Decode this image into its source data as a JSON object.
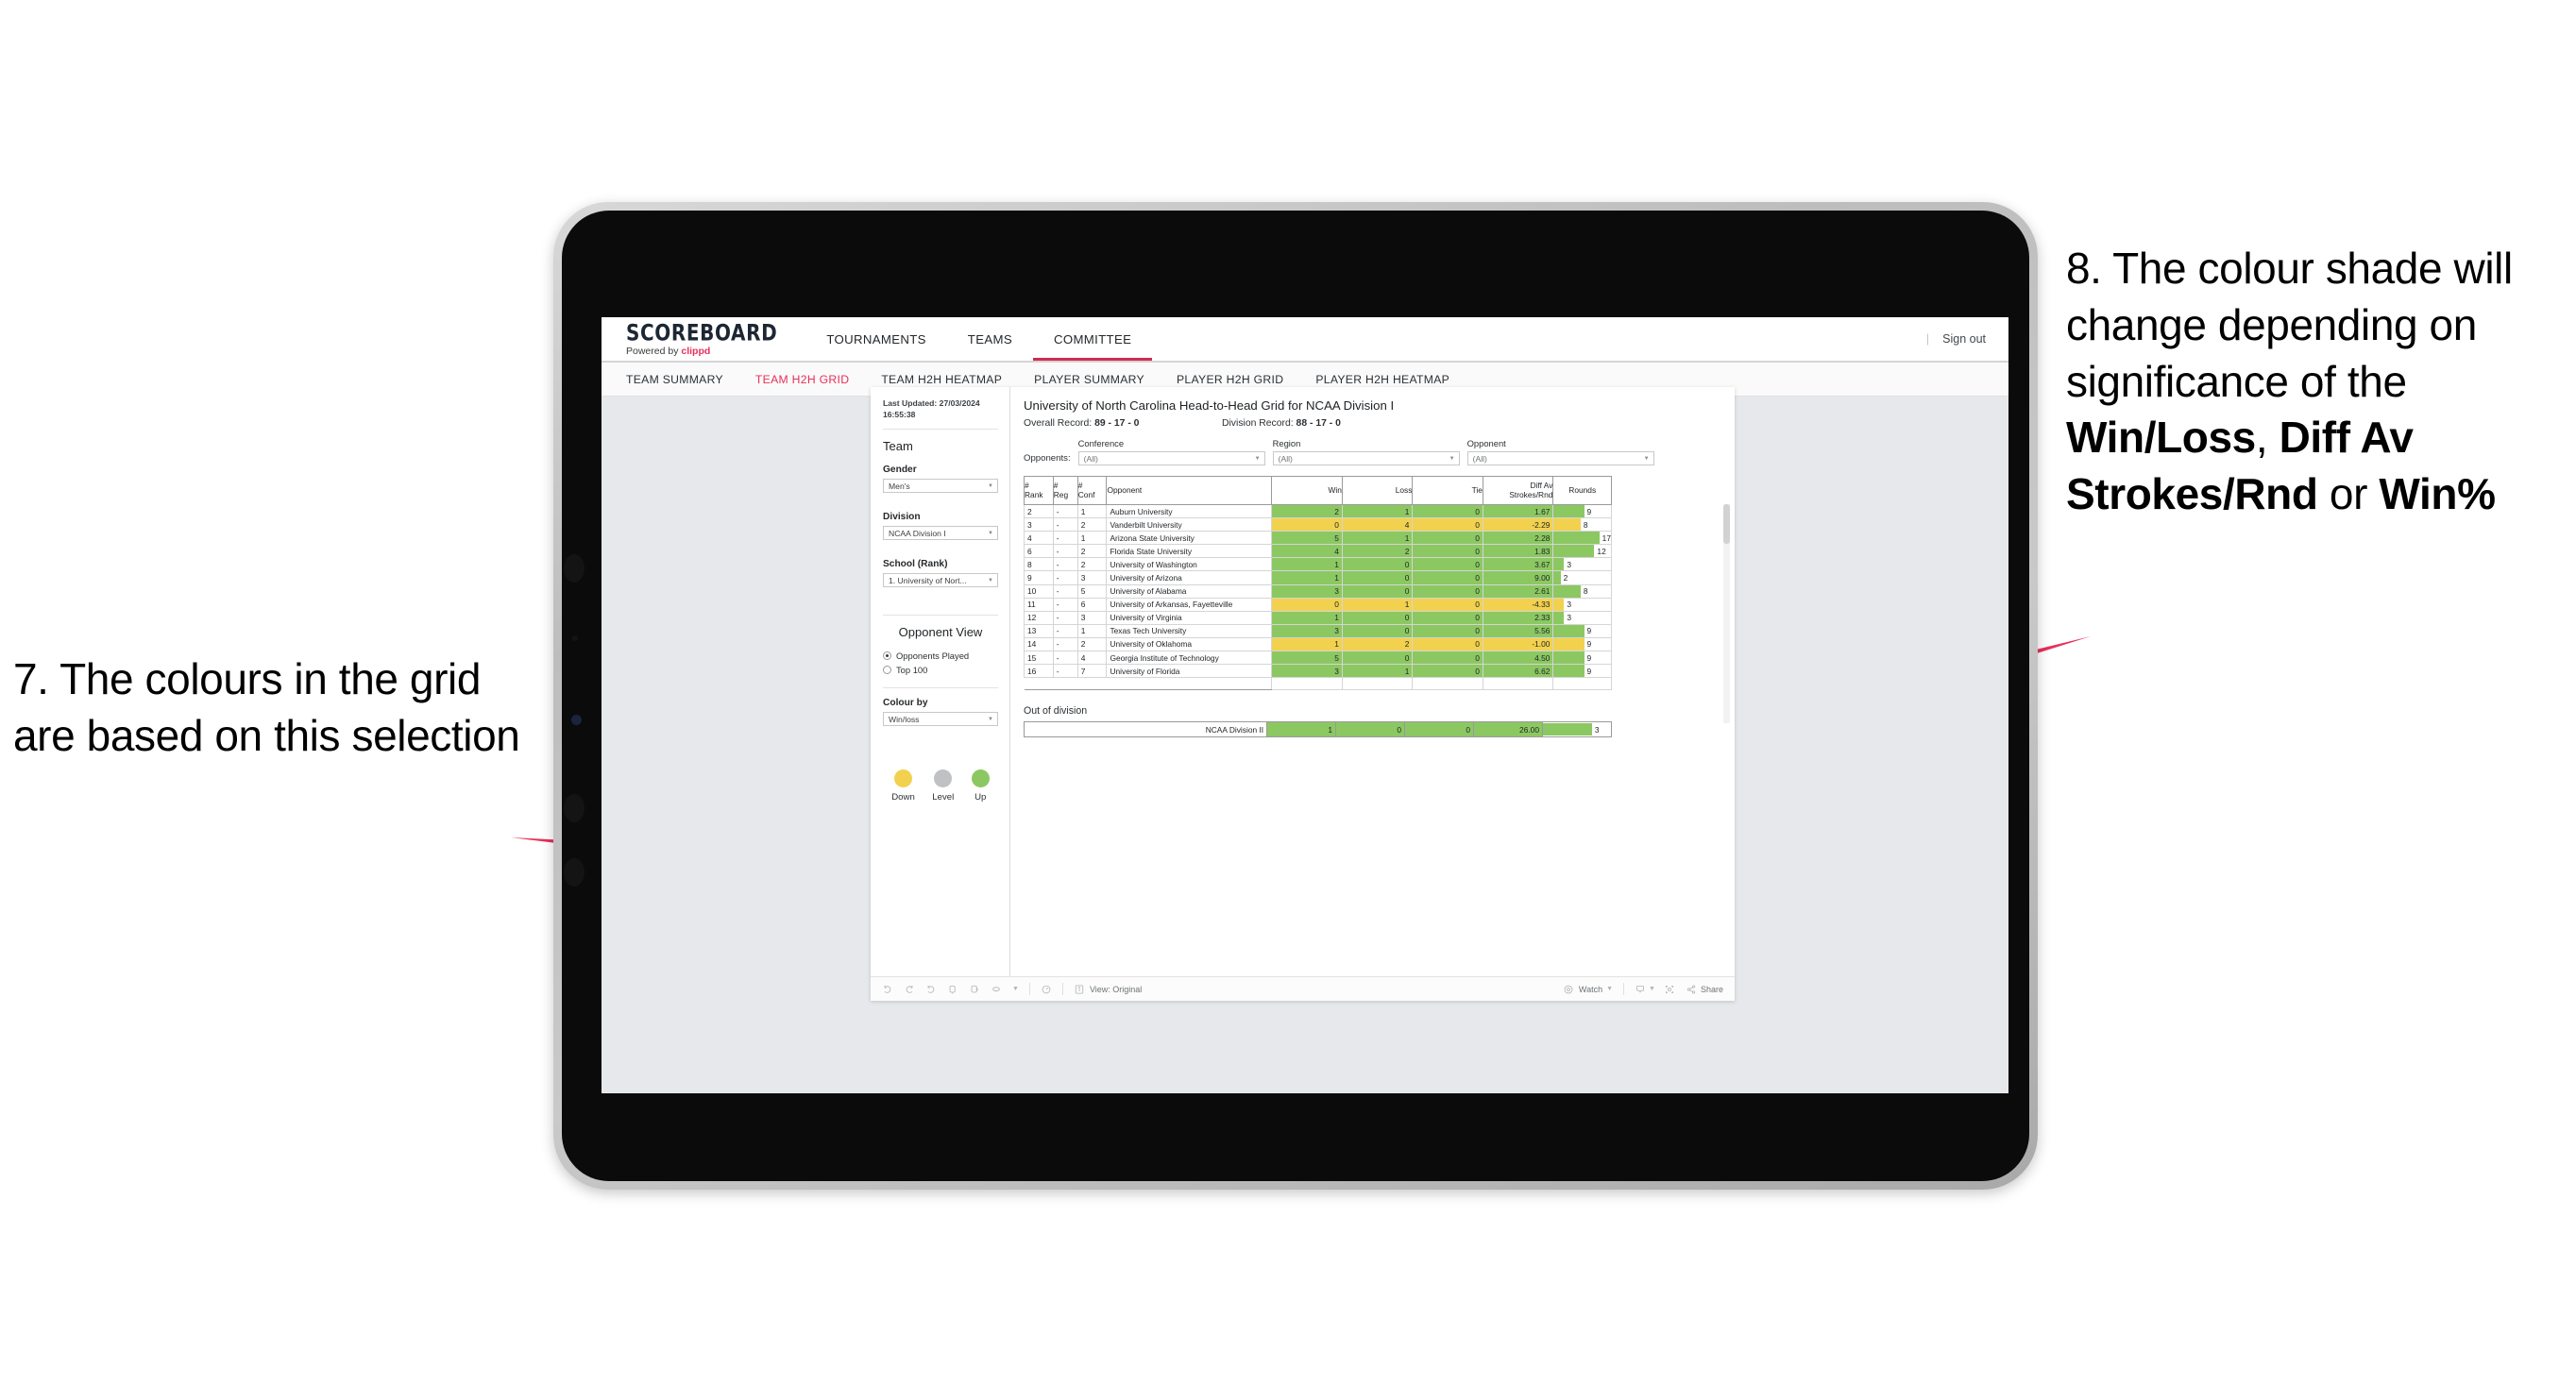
{
  "annotations": {
    "left": {
      "number": "7.",
      "text": "The colours in the grid are based on this selection"
    },
    "right": {
      "line1": "8. The colour shade will change depending on significance of the ",
      "bold1": "Win/Loss",
      "mid1": ", ",
      "bold2": "Diff Av Strokes/Rnd",
      "mid2": " or ",
      "bold3": "Win%"
    }
  },
  "app": {
    "brand": {
      "title": "SCOREBOARD",
      "powered_prefix": "Powered by ",
      "powered_name": "clippd"
    },
    "topnav": [
      {
        "label": "TOURNAMENTS",
        "active": false
      },
      {
        "label": "TEAMS",
        "active": false
      },
      {
        "label": "COMMITTEE",
        "active": true
      }
    ],
    "topnav_right": {
      "separator": "|",
      "signout": "Sign out"
    },
    "subnav": [
      {
        "label": "TEAM SUMMARY",
        "active": false
      },
      {
        "label": "TEAM H2H GRID",
        "active": true
      },
      {
        "label": "TEAM H2H HEATMAP",
        "active": false
      },
      {
        "label": "PLAYER SUMMARY",
        "active": false
      },
      {
        "label": "PLAYER H2H GRID",
        "active": false
      },
      {
        "label": "PLAYER H2H HEATMAP",
        "active": false
      }
    ]
  },
  "rail": {
    "last_updated_label": "Last Updated: 27/03/2024",
    "last_updated_time": "16:55:38",
    "team_heading": "Team",
    "gender_label": "Gender",
    "gender_value": "Men's",
    "division_label": "Division",
    "division_value": "NCAA Division I",
    "school_label": "School (Rank)",
    "school_value": "1. University of Nort...",
    "opponent_view_heading": "Opponent View",
    "opponent_view_options": [
      {
        "label": "Opponents Played",
        "selected": true
      },
      {
        "label": "Top 100",
        "selected": false
      }
    ],
    "colour_by_label": "Colour by",
    "colour_by_value": "Win/loss",
    "legend": [
      {
        "label": "Down",
        "color": "#f2d14e"
      },
      {
        "label": "Level",
        "color": "#bfc1c3"
      },
      {
        "label": "Up",
        "color": "#8cc862"
      }
    ]
  },
  "viz": {
    "title": "University of North Carolina Head-to-Head Grid for NCAA Division I",
    "overall_record_label": "Overall Record: ",
    "overall_record_value": "89 - 17 - 0",
    "division_record_label": "Division Record: ",
    "division_record_value": "88 - 17 - 0",
    "opponents_label": "Opponents:",
    "filters": [
      {
        "label": "Conference",
        "value": "(All)"
      },
      {
        "label": "Region",
        "value": "(All)"
      },
      {
        "label": "Opponent",
        "value": "(All)"
      }
    ],
    "columns": [
      {
        "l1": "#",
        "l2": "Rank"
      },
      {
        "l1": "#",
        "l2": "Reg"
      },
      {
        "l1": "#",
        "l2": "Conf"
      },
      {
        "l1": "Opponent",
        "l2": ""
      },
      {
        "l1": "Win",
        "l2": ""
      },
      {
        "l1": "Loss",
        "l2": ""
      },
      {
        "l1": "Tie",
        "l2": ""
      },
      {
        "l1": "Diff Av",
        "l2": "Strokes/Rnd"
      },
      {
        "l1": "Rounds",
        "l2": ""
      }
    ],
    "colors": {
      "up": "#8cc862",
      "down": "#f2d14e",
      "accent": "#e8305a"
    },
    "rows": [
      {
        "rank": "2",
        "reg": "-",
        "conf": "1",
        "opponent": "Auburn University",
        "win": "2",
        "loss": "1",
        "tie": "0",
        "diff": "1.67",
        "rounds": "9",
        "state": "up"
      },
      {
        "rank": "3",
        "reg": "-",
        "conf": "2",
        "opponent": "Vanderbilt University",
        "win": "0",
        "loss": "4",
        "tie": "0",
        "diff": "-2.29",
        "rounds": "8",
        "state": "down"
      },
      {
        "rank": "4",
        "reg": "-",
        "conf": "1",
        "opponent": "Arizona State University",
        "win": "5",
        "loss": "1",
        "tie": "0",
        "diff": "2.28",
        "rounds": "17",
        "state": "up"
      },
      {
        "rank": "6",
        "reg": "-",
        "conf": "2",
        "opponent": "Florida State University",
        "win": "4",
        "loss": "2",
        "tie": "0",
        "diff": "1.83",
        "rounds": "12",
        "state": "up"
      },
      {
        "rank": "8",
        "reg": "-",
        "conf": "2",
        "opponent": "University of Washington",
        "win": "1",
        "loss": "0",
        "tie": "0",
        "diff": "3.67",
        "rounds": "3",
        "state": "up"
      },
      {
        "rank": "9",
        "reg": "-",
        "conf": "3",
        "opponent": "University of Arizona",
        "win": "1",
        "loss": "0",
        "tie": "0",
        "diff": "9.00",
        "rounds": "2",
        "state": "up"
      },
      {
        "rank": "10",
        "reg": "-",
        "conf": "5",
        "opponent": "University of Alabama",
        "win": "3",
        "loss": "0",
        "tie": "0",
        "diff": "2.61",
        "rounds": "8",
        "state": "up"
      },
      {
        "rank": "11",
        "reg": "-",
        "conf": "6",
        "opponent": "University of Arkansas, Fayetteville",
        "win": "0",
        "loss": "1",
        "tie": "0",
        "diff": "-4.33",
        "rounds": "3",
        "state": "down"
      },
      {
        "rank": "12",
        "reg": "-",
        "conf": "3",
        "opponent": "University of Virginia",
        "win": "1",
        "loss": "0",
        "tie": "0",
        "diff": "2.33",
        "rounds": "3",
        "state": "up"
      },
      {
        "rank": "13",
        "reg": "-",
        "conf": "1",
        "opponent": "Texas Tech University",
        "win": "3",
        "loss": "0",
        "tie": "0",
        "diff": "5.56",
        "rounds": "9",
        "state": "up"
      },
      {
        "rank": "14",
        "reg": "-",
        "conf": "2",
        "opponent": "University of Oklahoma",
        "win": "1",
        "loss": "2",
        "tie": "0",
        "diff": "-1.00",
        "rounds": "9",
        "state": "down"
      },
      {
        "rank": "15",
        "reg": "-",
        "conf": "4",
        "opponent": "Georgia Institute of Technology",
        "win": "5",
        "loss": "0",
        "tie": "0",
        "diff": "4.50",
        "rounds": "9",
        "state": "up"
      },
      {
        "rank": "16",
        "reg": "-",
        "conf": "7",
        "opponent": "University of Florida",
        "win": "3",
        "loss": "1",
        "tie": "0",
        "diff": "6.62",
        "rounds": "9",
        "state": "up"
      }
    ],
    "out_of_division_title": "Out of division",
    "out_of_division_row": {
      "label": "NCAA Division II",
      "win": "1",
      "loss": "0",
      "tie": "0",
      "diff": "26.00",
      "rounds": "3",
      "state": "up"
    }
  },
  "toolbar": {
    "view_label": "View: Original",
    "watch_label": "Watch",
    "share_label": "Share"
  },
  "chart_data": {
    "type": "table",
    "title": "University of North Carolina Head-to-Head Grid for NCAA Division I",
    "columns": [
      "# Rank",
      "# Reg",
      "# Conf",
      "Opponent",
      "Win",
      "Loss",
      "Tie",
      "Diff Av Strokes/Rnd",
      "Rounds"
    ],
    "colour_by": "Win/loss",
    "legend": {
      "Down": "#f2d14e",
      "Level": "#bfc1c3",
      "Up": "#8cc862"
    },
    "rounds_axis_max": 17,
    "rows": [
      [
        "2",
        "-",
        "1",
        "Auburn University",
        2,
        1,
        0,
        1.67,
        9
      ],
      [
        "3",
        "-",
        "2",
        "Vanderbilt University",
        0,
        4,
        0,
        -2.29,
        8
      ],
      [
        "4",
        "-",
        "1",
        "Arizona State University",
        5,
        1,
        0,
        2.28,
        17
      ],
      [
        "6",
        "-",
        "2",
        "Florida State University",
        4,
        2,
        0,
        1.83,
        12
      ],
      [
        "8",
        "-",
        "2",
        "University of Washington",
        1,
        0,
        0,
        3.67,
        3
      ],
      [
        "9",
        "-",
        "3",
        "University of Arizona",
        1,
        0,
        0,
        9.0,
        2
      ],
      [
        "10",
        "-",
        "5",
        "University of Alabama",
        3,
        0,
        0,
        2.61,
        8
      ],
      [
        "11",
        "-",
        "6",
        "University of Arkansas, Fayetteville",
        0,
        1,
        0,
        -4.33,
        3
      ],
      [
        "12",
        "-",
        "3",
        "University of Virginia",
        1,
        0,
        0,
        2.33,
        3
      ],
      [
        "13",
        "-",
        "1",
        "Texas Tech University",
        3,
        0,
        0,
        5.56,
        9
      ],
      [
        "14",
        "-",
        "2",
        "University of Oklahoma",
        1,
        2,
        0,
        -1.0,
        9
      ],
      [
        "15",
        "-",
        "4",
        "Georgia Institute of Technology",
        5,
        0,
        0,
        4.5,
        9
      ],
      [
        "16",
        "-",
        "7",
        "University of Florida",
        3,
        1,
        0,
        6.62,
        9
      ]
    ],
    "out_of_division": [
      [
        "NCAA Division II",
        1,
        0,
        0,
        26.0,
        3
      ]
    ],
    "records": {
      "overall": "89 - 17 - 0",
      "division": "88 - 17 - 0"
    }
  }
}
